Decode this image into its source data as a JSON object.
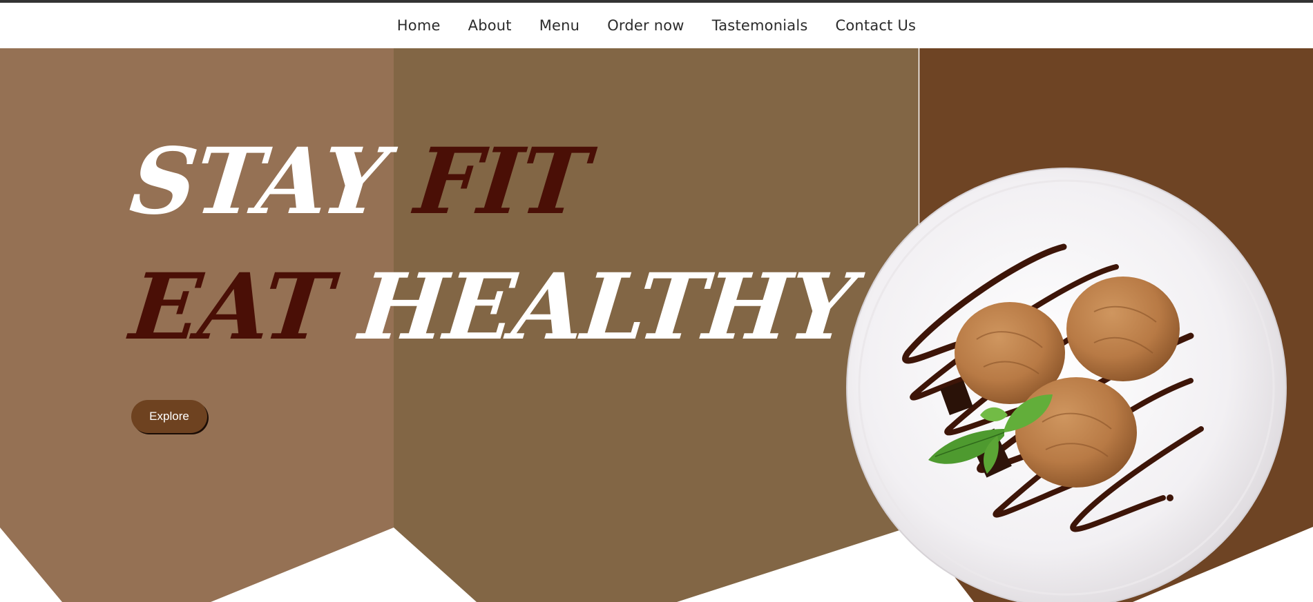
{
  "nav": {
    "items": [
      {
        "label": "Home"
      },
      {
        "label": "About"
      },
      {
        "label": "Menu"
      },
      {
        "label": "Order now"
      },
      {
        "label": "Tastemonials"
      },
      {
        "label": "Contact Us"
      }
    ]
  },
  "hero": {
    "line1": {
      "word1": "STAY",
      "word2": "FIT"
    },
    "line2": {
      "word1": "EAT",
      "word2": "HEALTHY"
    },
    "explore_label": "Explore"
  },
  "colors": {
    "panel_light": "#957154",
    "panel_mid": "#826645",
    "panel_dark": "#6e4424",
    "accent_dark_text": "#4a0f06",
    "button_bg": "#6e4220"
  },
  "icons": {
    "hero_image": "ice-cream-plate-image"
  }
}
